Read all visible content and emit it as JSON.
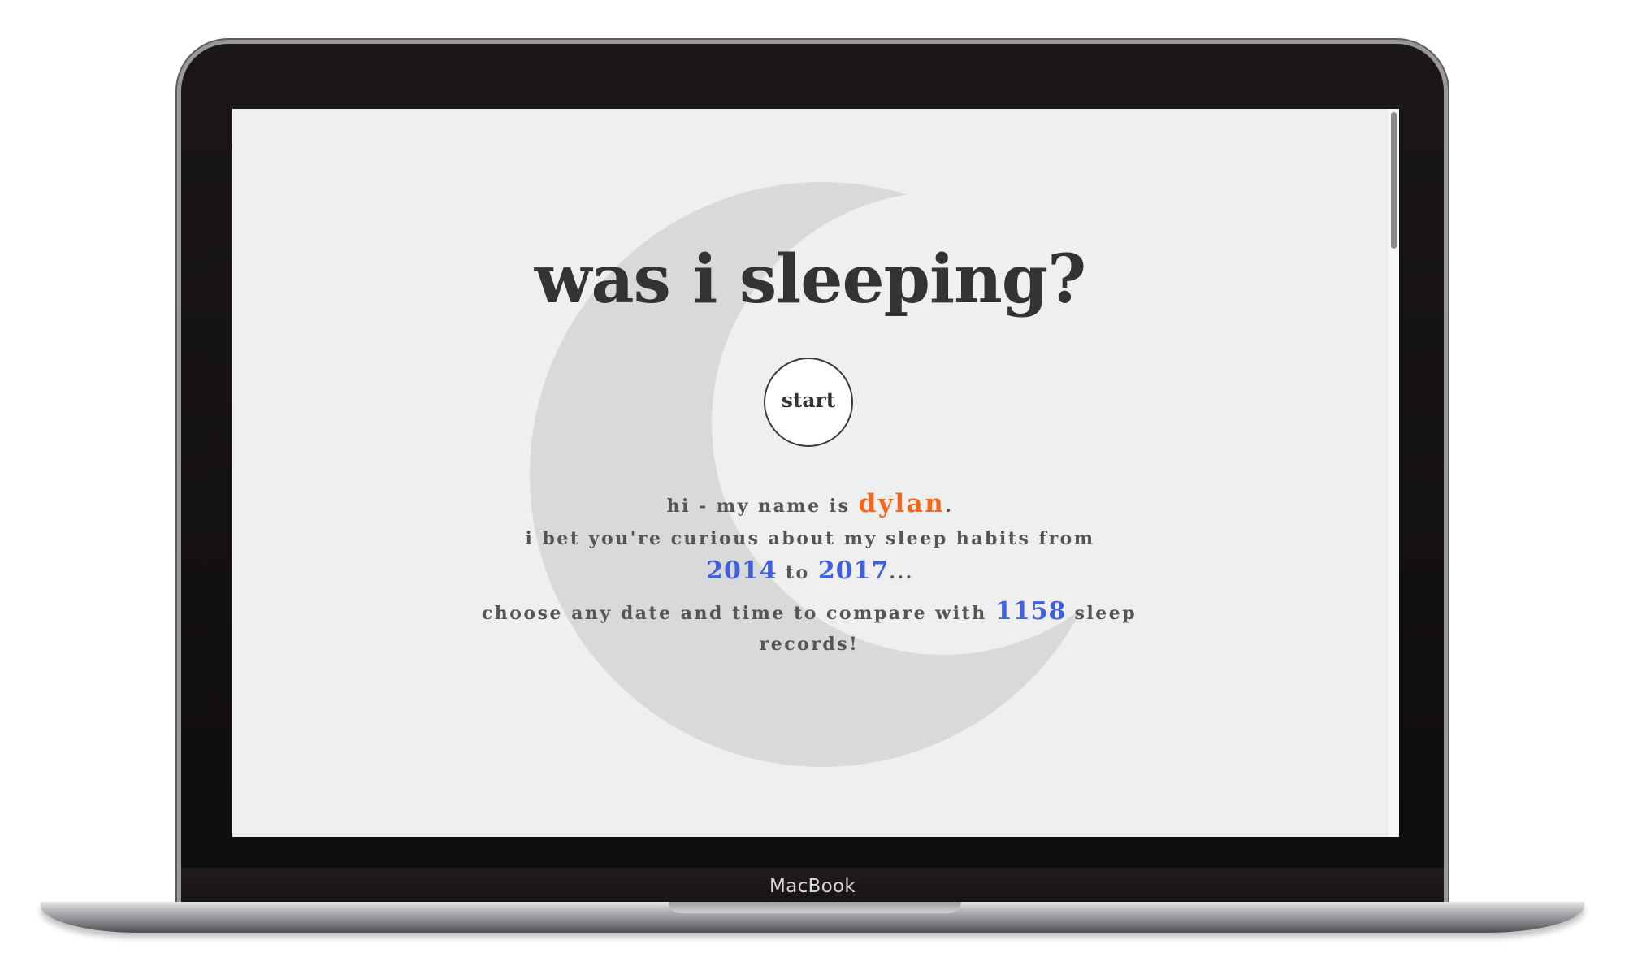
{
  "device": {
    "label": "MacBook"
  },
  "page": {
    "title": "was i sleeping?",
    "start_label": "start",
    "intro": {
      "part1": "hi - my name is ",
      "name": "dylan",
      "part2": ".",
      "line2": "i bet you're curious about my sleep habits from",
      "year_start": "2014",
      "to_word": " to ",
      "year_end": "2017",
      "ellipsis": "..."
    },
    "compare": {
      "part1": "choose any date and time to compare with ",
      "count": "1158",
      "part2": " sleep records!"
    }
  },
  "colors": {
    "background": "#efefef",
    "moon": "#d9d9d9",
    "text": "#333333",
    "accent_orange": "#f5661b",
    "accent_blue": "#3e5fe0"
  }
}
